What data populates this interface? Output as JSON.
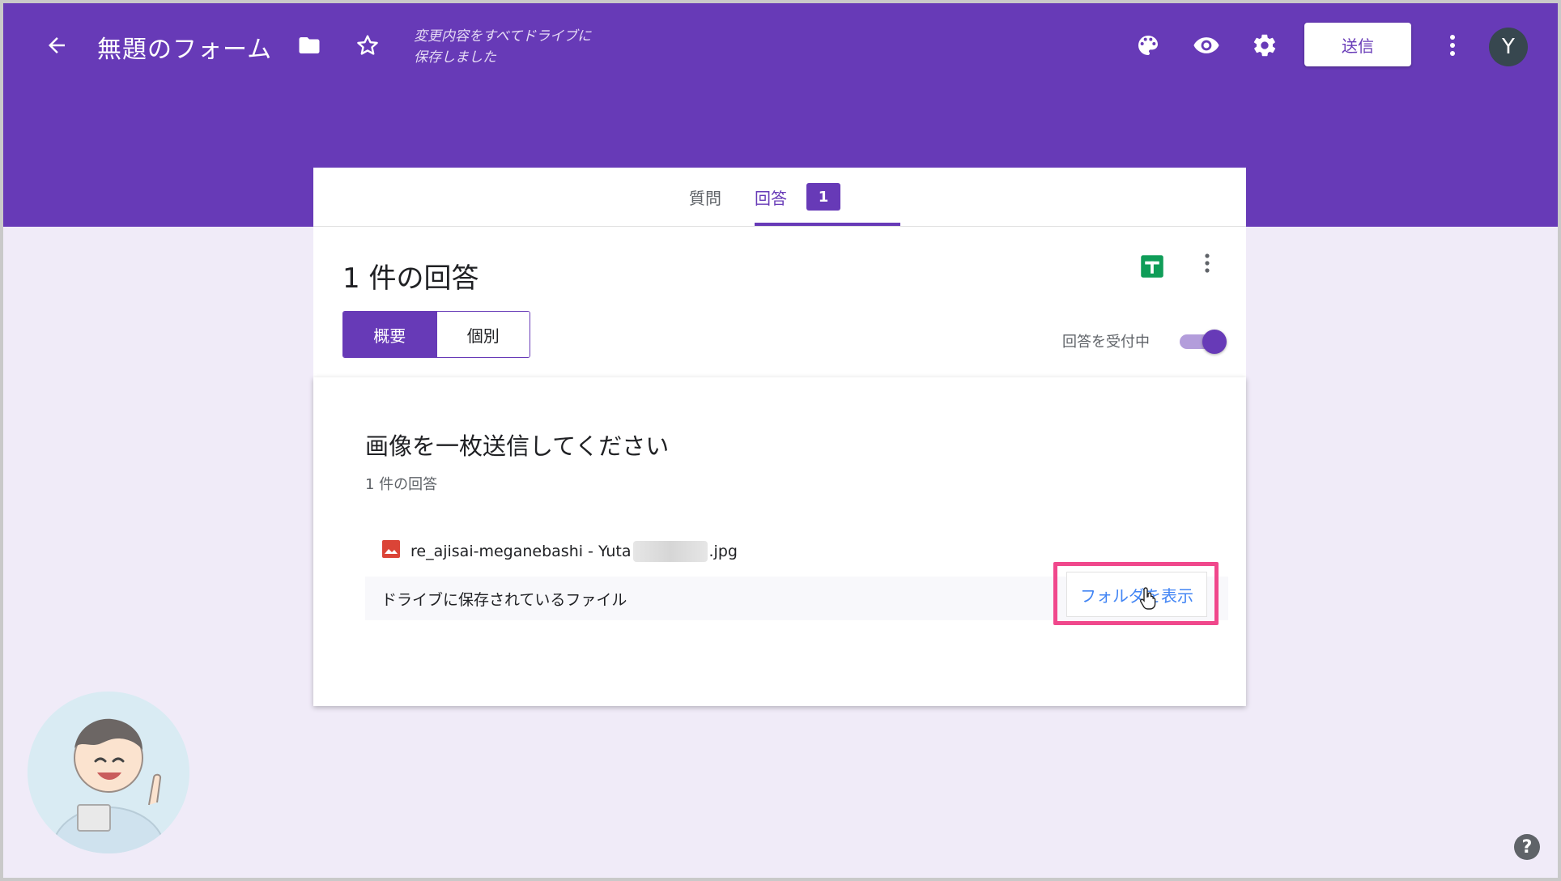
{
  "header": {
    "title": "無題のフォーム",
    "saved_line1": "変更内容をすべてドライブに",
    "saved_line2": "保存しました",
    "send_label": "送信",
    "avatar_letter": "Y"
  },
  "tabs": {
    "questions_label": "質問",
    "responses_label": "回答",
    "responses_count": "1"
  },
  "summary": {
    "title": "1 件の回答",
    "view_summary": "概要",
    "view_individual": "個別",
    "accepting_label": "回答を受付中"
  },
  "question": {
    "title": "画像を一枚送信してください",
    "count": "1 件の回答",
    "file_name_start": "re_ajisai-meganebashi - Yuta",
    "file_ext": ".jpg",
    "drive_label": "ドライブに保存されているファイル",
    "view_folder": "フォルダを表示"
  },
  "help_label": "?",
  "colors": {
    "primary": "#673ab7",
    "background": "#f0ebf8",
    "link": "#4285f4",
    "highlight": "#f0488c",
    "sheets": "#0f9d58"
  }
}
